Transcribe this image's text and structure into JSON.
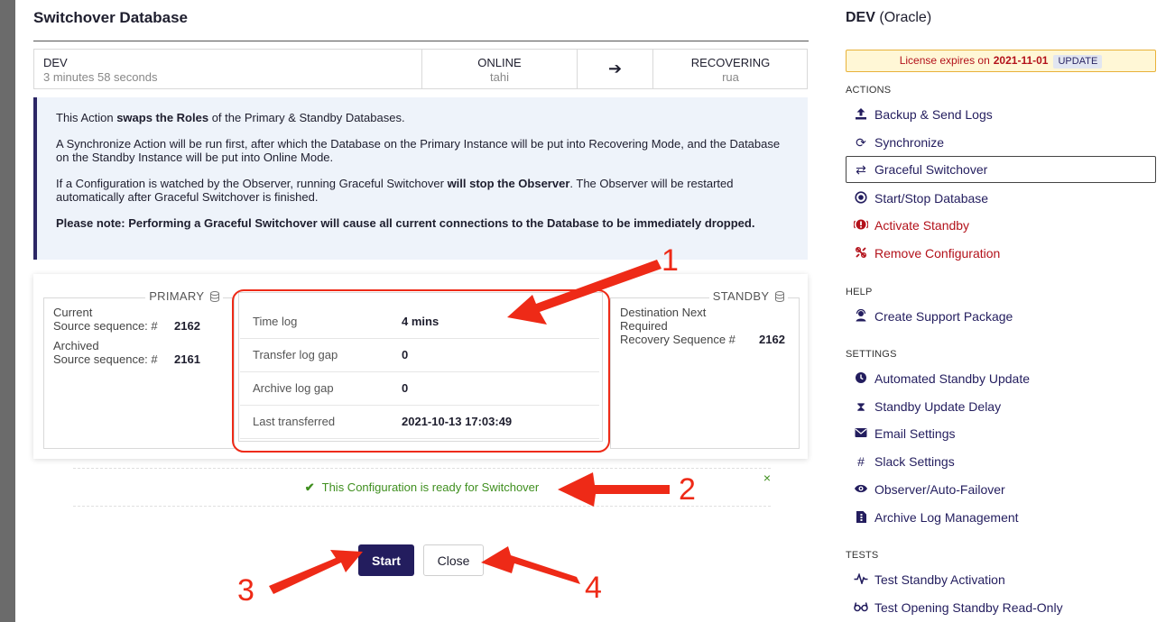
{
  "dialog": {
    "title": "Switchover Database",
    "status": {
      "source_name": "DEV",
      "source_elapsed": "3 minutes 58 seconds",
      "primary_state": "ONLINE",
      "primary_host": "tahi",
      "arrow_icon": "arrow-right-icon",
      "standby_state": "RECOVERING",
      "standby_host": "rua"
    },
    "info": {
      "p1_pre": "This Action ",
      "p1_bold": "swaps the Roles",
      "p1_post": " of the Primary & Standby Databases.",
      "p2": "A Synchronize Action will be run first, after which the Database on the Primary Instance will be put into Recovering Mode, and the Database on the Standby Instance will be put into Online Mode.",
      "p3_pre": "If a Configuration is watched by the Observer, running Graceful Switchover ",
      "p3_bold": "will stop the Observer",
      "p3_post": ". The Observer will be restarted automatically after Graceful Switchover is finished.",
      "p4": "Please note: Performing a Graceful Switchover will cause all current connections to the Database to be immediately dropped."
    },
    "primary": {
      "legend": "PRIMARY",
      "current_label_1": "Current",
      "current_label_2": "Source sequence: #",
      "current_value": "2162",
      "archived_label_1": "Archived",
      "archived_label_2": "Source sequence: #",
      "archived_value": "2161"
    },
    "standby": {
      "legend": "STANDBY",
      "dest_label_1": "Destination Next",
      "dest_label_2": "Required",
      "dest_label_3": "Recovery Sequence #",
      "dest_value": "2162"
    },
    "metrics": [
      {
        "label": "Time log",
        "value": "4 mins"
      },
      {
        "label": "Transfer log gap",
        "value": "0"
      },
      {
        "label": "Archive log gap",
        "value": "0"
      },
      {
        "label": "Last transferred",
        "value": "2021-10-13 17:03:49"
      }
    ],
    "ready_message": "This Configuration is ready for Switchover",
    "dismiss_glyph": "×",
    "start_label": "Start",
    "close_label": "Close"
  },
  "annotations": [
    "1",
    "2",
    "3",
    "4"
  ],
  "annotation_color": "#ee2a17",
  "sidebar": {
    "db_name": "DEV",
    "db_type": "(Oracle)",
    "license_text": "License expires on",
    "license_date": "2021-11-01",
    "license_update": "UPDATE",
    "sections": {
      "actions": "ACTIONS",
      "help": "HELP",
      "settings": "SETTINGS",
      "tests": "TESTS"
    },
    "actions": [
      {
        "label": "Backup & Send Logs",
        "icon": "upload-icon"
      },
      {
        "label": "Synchronize",
        "icon": "sync-icon"
      },
      {
        "label": "Graceful Switchover",
        "icon": "switch-arrows-icon"
      },
      {
        "label": "Start/Stop Database",
        "icon": "power-circle-icon"
      },
      {
        "label": "Activate Standby",
        "icon": "alert-circle-icon"
      },
      {
        "label": "Remove Configuration",
        "icon": "unlink-icon"
      }
    ],
    "help": [
      {
        "label": "Create Support Package",
        "icon": "support-agent-icon"
      }
    ],
    "settings": [
      {
        "label": "Automated Standby Update",
        "icon": "clock-icon"
      },
      {
        "label": "Standby Update Delay",
        "icon": "hourglass-icon"
      },
      {
        "label": "Email Settings",
        "icon": "envelope-icon"
      },
      {
        "label": "Slack Settings",
        "icon": "slack-icon"
      },
      {
        "label": "Observer/Auto-Failover",
        "icon": "eye-icon"
      },
      {
        "label": "Archive Log Management",
        "icon": "file-archive-icon"
      }
    ],
    "tests": [
      {
        "label": "Test Standby Activation",
        "icon": "heartbeat-icon"
      },
      {
        "label": "Test Opening Standby Read-Only",
        "icon": "glasses-icon"
      }
    ]
  },
  "colors": {
    "brand_navy": "#231d5e",
    "danger_red": "#b3121b",
    "success_green": "#3f8f1f",
    "info_bg": "#eef3fa",
    "license_bg": "#fff7d6",
    "license_border": "#e8b23a"
  }
}
